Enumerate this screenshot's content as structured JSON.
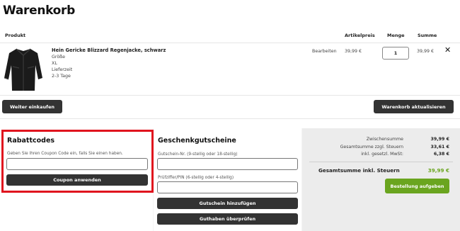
{
  "page": {
    "title": "Warenkorb"
  },
  "table": {
    "headers": {
      "product": "Produkt",
      "unit_price": "Artikelpreis",
      "quantity": "Menge",
      "sum": "Summe"
    },
    "item": {
      "name": "Hein Gericke Blizzard Regenjacke, schwarz",
      "attr_size_label": "Größe",
      "attr_size_value": "XL",
      "attr_delivery_label": "Lieferzeit",
      "attr_delivery_value": "2-3 Tage",
      "edit_label": "Bearbeiten",
      "price": "39,99 €",
      "quantity": "1",
      "sum": "39,99 €",
      "remove_glyph": "✕",
      "image_icon": "jacket-image"
    }
  },
  "actions": {
    "continue_label": "Weiter einkaufen",
    "update_label": "Warenkorb aktualisieren"
  },
  "coupon": {
    "title": "Rabattcodes",
    "hint": "Geben Sie Ihren Coupon Code ein, falls Sie einen haben.",
    "input_value": "",
    "button_label": "Coupon anwenden"
  },
  "giftcard": {
    "title": "Geschenkgutscheine",
    "number_hint": "Gutschein-Nr. (9-stellig oder 18-stellig)",
    "number_value": "",
    "pin_hint": "Prüfziffer/PIN (6-stellig oder 4-stellig)",
    "pin_value": "",
    "add_label": "Gutschein hinzufügen",
    "check_label": "Guthaben überprüfen"
  },
  "totals": {
    "subtotal_label": "Zwischensumme",
    "subtotal_value": "39,99 €",
    "net_label": "Gesamtsumme zzgl. Steuern",
    "net_value": "33,61 €",
    "tax_label": "inkl. gesetzl. MwSt:",
    "tax_value": "6,38 €",
    "grand_label": "Gesamtsumme inkl. Steuern",
    "grand_value": "39,99 €",
    "checkout_label": "Bestellung aufgeben"
  },
  "colors": {
    "highlight": "#e0141e",
    "accent_green": "#6aa51f",
    "button_dark": "#333333"
  }
}
